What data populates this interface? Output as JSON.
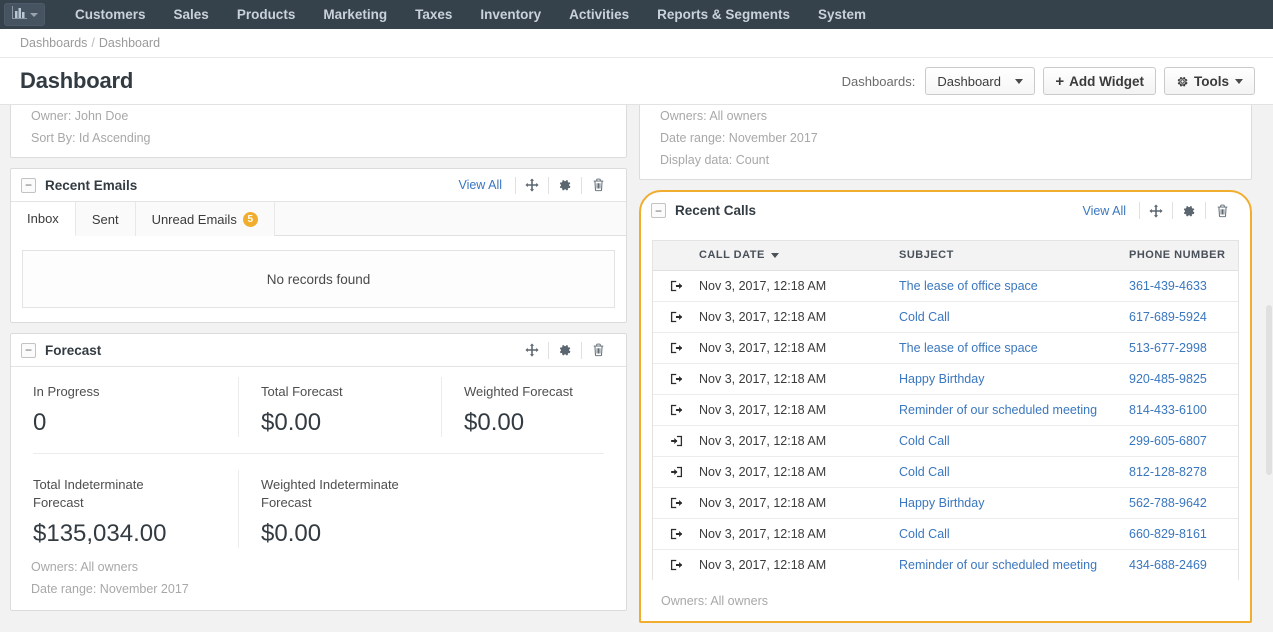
{
  "topnav": {
    "logo_icon": "bar-chart-icon",
    "items": [
      {
        "label": "Customers"
      },
      {
        "label": "Sales"
      },
      {
        "label": "Products"
      },
      {
        "label": "Marketing"
      },
      {
        "label": "Taxes"
      },
      {
        "label": "Inventory"
      },
      {
        "label": "Activities"
      },
      {
        "label": "Reports & Segments"
      },
      {
        "label": "System"
      }
    ]
  },
  "breadcrumb": {
    "root": "Dashboards",
    "separator": "/",
    "current": "Dashboard"
  },
  "page": {
    "title": "Dashboard",
    "dashboards_label": "Dashboards:",
    "dashboard_select_value": "Dashboard",
    "add_widget_label": "Add Widget",
    "add_widget_plus": "+",
    "tools_label": "Tools"
  },
  "colors": {
    "navbar": "#35414b",
    "accent_orange": "#f0ad2e",
    "link_blue": "#3a77be",
    "page_bg": "#f2f2f2",
    "text_dark": "#333b42",
    "muted": "#a8a8a8"
  },
  "widgets": {
    "clipped_left": {
      "lines": [
        "Owner: John Doe",
        "Sort By: Id Ascending"
      ]
    },
    "recent_emails": {
      "title": "Recent Emails",
      "collapse_glyph": "−",
      "view_all": "View All",
      "tabs": [
        {
          "label": "Inbox",
          "active": true,
          "badge": ""
        },
        {
          "label": "Sent",
          "active": false,
          "badge": ""
        },
        {
          "label": "Unread Emails",
          "active": false,
          "badge": "5"
        }
      ],
      "empty_text": "No records found"
    },
    "forecast": {
      "title": "Forecast",
      "collapse_glyph": "−",
      "cells_top": [
        {
          "label": "In Progress",
          "value": "0"
        },
        {
          "label": "Total Forecast",
          "value": "$0.00"
        },
        {
          "label": "Weighted Forecast",
          "value": "$0.00"
        }
      ],
      "cells_bottom": [
        {
          "label": "Total Indeterminate Forecast",
          "value": "$135,034.00"
        },
        {
          "label": "Weighted Indeterminate Forecast",
          "value": "$0.00"
        }
      ],
      "meta": [
        "Owners: All owners",
        "Date range: November 2017"
      ]
    },
    "clipped_right": {
      "lines": [
        "Owners: All owners",
        "Date range: November 2017",
        "Display data: Count"
      ]
    },
    "recent_calls": {
      "title": "Recent Calls",
      "collapse_glyph": "−",
      "view_all": "View All",
      "highlighted": true,
      "columns": [
        "",
        "CALL DATE",
        "SUBJECT",
        "PHONE NUMBER"
      ],
      "sorted_column": "CALL DATE",
      "sort_direction": "desc",
      "rows": [
        {
          "direction": "outgoing",
          "date": "Nov 3, 2017, 12:18 AM",
          "subject": "The lease of office space",
          "phone": "361-439-4633"
        },
        {
          "direction": "outgoing",
          "date": "Nov 3, 2017, 12:18 AM",
          "subject": "Cold Call",
          "phone": "617-689-5924"
        },
        {
          "direction": "outgoing",
          "date": "Nov 3, 2017, 12:18 AM",
          "subject": "The lease of office space",
          "phone": "513-677-2998"
        },
        {
          "direction": "outgoing",
          "date": "Nov 3, 2017, 12:18 AM",
          "subject": "Happy Birthday",
          "phone": "920-485-9825"
        },
        {
          "direction": "outgoing",
          "date": "Nov 3, 2017, 12:18 AM",
          "subject": "Reminder of our scheduled meeting",
          "phone": "814-433-6100"
        },
        {
          "direction": "incoming",
          "date": "Nov 3, 2017, 12:18 AM",
          "subject": "Cold Call",
          "phone": "299-605-6807"
        },
        {
          "direction": "incoming",
          "date": "Nov 3, 2017, 12:18 AM",
          "subject": "Cold Call",
          "phone": "812-128-8278"
        },
        {
          "direction": "outgoing",
          "date": "Nov 3, 2017, 12:18 AM",
          "subject": "Happy Birthday",
          "phone": "562-788-9642"
        },
        {
          "direction": "outgoing",
          "date": "Nov 3, 2017, 12:18 AM",
          "subject": "Cold Call",
          "phone": "660-829-8161"
        },
        {
          "direction": "outgoing",
          "date": "Nov 3, 2017, 12:18 AM",
          "subject": "Reminder of our scheduled meeting",
          "phone": "434-688-2469"
        }
      ],
      "meta": [
        "Owners: All owners"
      ]
    }
  },
  "widget_tools": {
    "move_icon": "move-icon",
    "settings_icon": "gear-icon",
    "delete_icon": "trash-icon"
  }
}
